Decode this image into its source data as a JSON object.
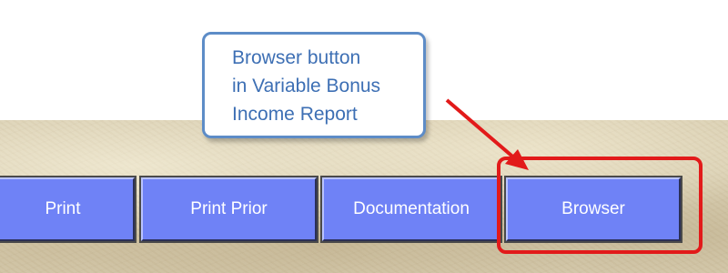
{
  "toolbar": {
    "buttons": [
      {
        "label": "Print"
      },
      {
        "label": "Print Prior"
      },
      {
        "label": "Documentation"
      },
      {
        "label": "Browser"
      }
    ]
  },
  "callout": {
    "lines": [
      "Browser button",
      "in Variable Bonus",
      "Income Report"
    ]
  },
  "colors": {
    "button_fill": "#6f82f6",
    "highlight": "#e21a1a",
    "callout_border": "#5d8cc7",
    "callout_text": "#3d6fb4"
  }
}
